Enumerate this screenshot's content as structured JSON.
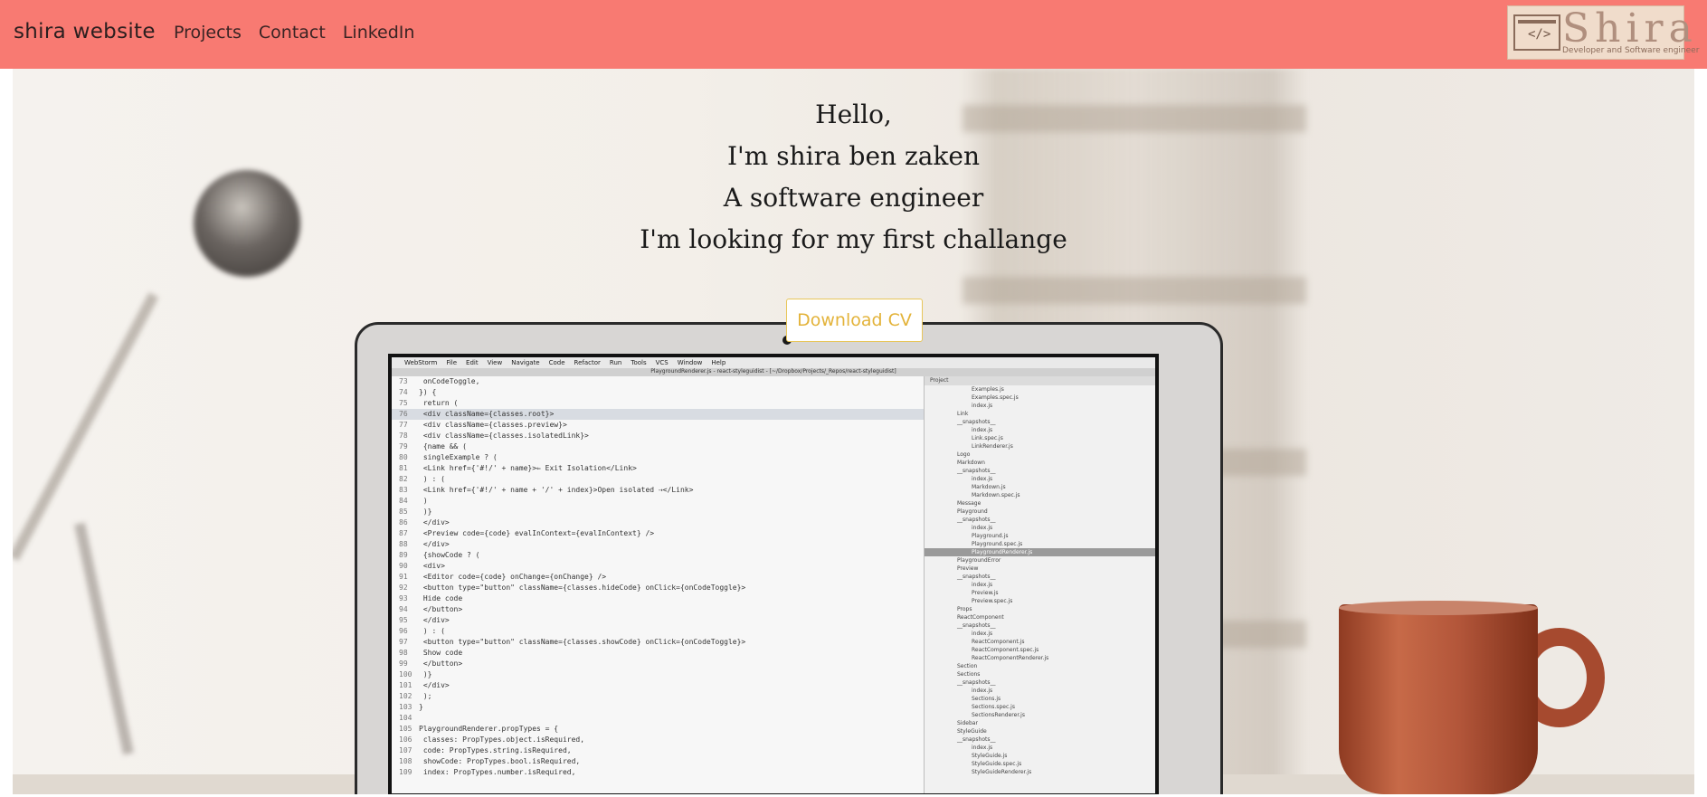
{
  "navbar": {
    "brand": "shira website",
    "links": [
      "Projects",
      "Contact",
      "LinkedIn"
    ],
    "logo": {
      "text": "Shira",
      "subtitle": "Developer and Software engineer",
      "code_glyph": "</>"
    }
  },
  "hero": {
    "lines": [
      "Hello,",
      "I'm shira ben zaken",
      "A software engineer",
      "I'm looking for my first challange"
    ],
    "download_button": "Download CV"
  },
  "laptop_screen": {
    "menu_items": [
      "WebStorm",
      "File",
      "Edit",
      "View",
      "Navigate",
      "Code",
      "Refactor",
      "Run",
      "Tools",
      "VCS",
      "Window",
      "Help"
    ],
    "title": "PlaygroundRenderer.js - react-styleguidist - [~/Dropbox/Projects/_Repos/react-styleguidist]",
    "code_lines": [
      {
        "ln": "73",
        "text": "    onCodeToggle,"
      },
      {
        "ln": "74",
        "text": "}) {"
      },
      {
        "ln": "75",
        "text": "    return ("
      },
      {
        "ln": "76",
        "text": "        <div className={classes.root}>"
      },
      {
        "ln": "77",
        "text": "            <div className={classes.preview}>"
      },
      {
        "ln": "78",
        "text": "                <div className={classes.isolatedLink}>"
      },
      {
        "ln": "79",
        "text": "                    {name && ("
      },
      {
        "ln": "80",
        "text": "                        singleExample ? ("
      },
      {
        "ln": "81",
        "text": "                            <Link href={'#!/' + name}>⇐ Exit Isolation</Link>"
      },
      {
        "ln": "82",
        "text": "                        ) : ("
      },
      {
        "ln": "83",
        "text": "                            <Link href={'#!/' + name + '/' + index}>Open isolated ⇢</Link>"
      },
      {
        "ln": "84",
        "text": "                        )"
      },
      {
        "ln": "85",
        "text": "                    )}"
      },
      {
        "ln": "86",
        "text": "                </div>"
      },
      {
        "ln": "87",
        "text": "                <Preview code={code} evalInContext={evalInContext} />"
      },
      {
        "ln": "88",
        "text": "            </div>"
      },
      {
        "ln": "89",
        "text": "            {showCode ? ("
      },
      {
        "ln": "90",
        "text": "                <div>"
      },
      {
        "ln": "91",
        "text": "                    <Editor code={code} onChange={onChange} />"
      },
      {
        "ln": "92",
        "text": "                    <button type=\"button\" className={classes.hideCode} onClick={onCodeToggle}>"
      },
      {
        "ln": "93",
        "text": "                        Hide code"
      },
      {
        "ln": "94",
        "text": "                    </button>"
      },
      {
        "ln": "95",
        "text": "                </div>"
      },
      {
        "ln": "96",
        "text": "            ) : ("
      },
      {
        "ln": "97",
        "text": "                <button type=\"button\" className={classes.showCode} onClick={onCodeToggle}>"
      },
      {
        "ln": "98",
        "text": "                    Show code"
      },
      {
        "ln": "99",
        "text": "                </button>"
      },
      {
        "ln": "100",
        "text": "            )}"
      },
      {
        "ln": "101",
        "text": "        </div>"
      },
      {
        "ln": "102",
        "text": "    );"
      },
      {
        "ln": "103",
        "text": "}"
      },
      {
        "ln": "104",
        "text": ""
      },
      {
        "ln": "105",
        "text": "PlaygroundRenderer.propTypes = {"
      },
      {
        "ln": "106",
        "text": "    classes: PropTypes.object.isRequired,"
      },
      {
        "ln": "107",
        "text": "    code: PropTypes.string.isRequired,"
      },
      {
        "ln": "108",
        "text": "    showCode: PropTypes.bool.isRequired,"
      },
      {
        "ln": "109",
        "text": "    index: PropTypes.number.isRequired,"
      }
    ],
    "project_header": "Project",
    "project_items": [
      "Examples.js",
      "Examples.spec.js",
      "index.js",
      "Link",
      "__snapshots__",
      "index.js",
      "Link.spec.js",
      "LinkRenderer.js",
      "Logo",
      "Markdown",
      "__snapshots__",
      "index.js",
      "Markdown.js",
      "Markdown.spec.js",
      "Message",
      "Playground",
      "__snapshots__",
      "index.js",
      "Playground.js",
      "Playground.spec.js",
      "PlaygroundRenderer.js",
      "PlaygroundError",
      "Preview",
      "__snapshots__",
      "index.js",
      "Preview.js",
      "Preview.spec.js",
      "Props",
      "ReactComponent",
      "__snapshots__",
      "index.js",
      "ReactComponent.js",
      "ReactComponent.spec.js",
      "ReactComponentRenderer.js",
      "Section",
      "Sections",
      "__snapshots__",
      "index.js",
      "Sections.js",
      "Sections.spec.js",
      "SectionsRenderer.js",
      "Sidebar",
      "StyleGuide",
      "__snapshots__",
      "index.js",
      "StyleGuide.js",
      "StyleGuide.spec.js",
      "StyleGuideRenderer.js"
    ],
    "selected_item": "PlaygroundRenderer.js"
  }
}
